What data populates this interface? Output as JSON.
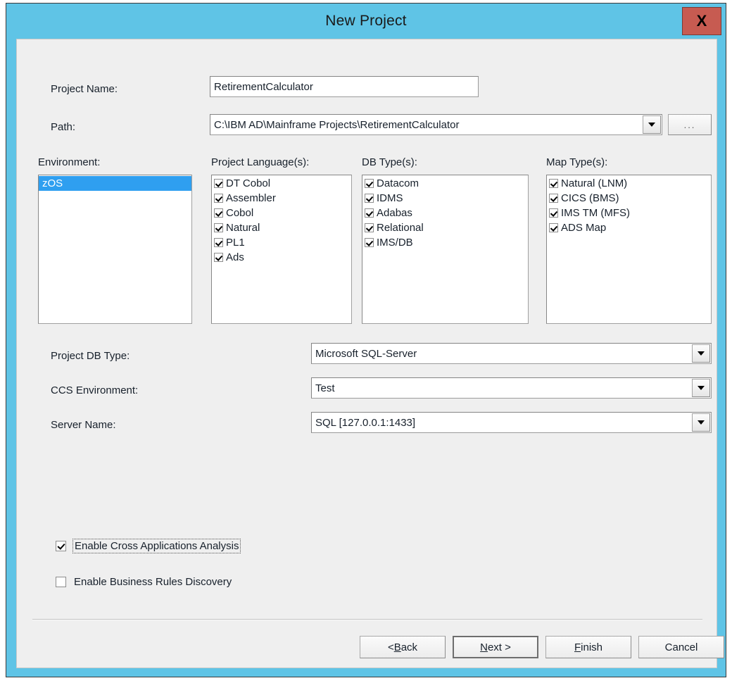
{
  "window": {
    "title": "New Project",
    "close_label": "X",
    "frame_color": "#5fc4e6",
    "close_color": "#c75b51"
  },
  "form": {
    "project_name": {
      "label": "Project Name:",
      "value": "RetirementCalculator"
    },
    "path": {
      "label": "Path:",
      "value": "C:\\IBM AD\\Mainframe Projects\\RetirementCalculator",
      "browse_label": "..."
    },
    "project_db_type": {
      "label": "Project DB Type:",
      "value": "Microsoft SQL-Server"
    },
    "ccs_environment": {
      "label": "CCS Environment:",
      "value": "Test"
    },
    "server_name": {
      "label": "Server Name:",
      "value": "SQL [127.0.0.1:1433]"
    }
  },
  "environment": {
    "label": "Environment:",
    "items": [
      {
        "label": "zOS",
        "selected": true
      }
    ],
    "selection_color": "#2f9ff0"
  },
  "project_languages": {
    "label": "Project Language(s):",
    "items": [
      {
        "label": "DT Cobol",
        "checked": true
      },
      {
        "label": "Assembler",
        "checked": true
      },
      {
        "label": "Cobol",
        "checked": true
      },
      {
        "label": "Natural",
        "checked": true
      },
      {
        "label": "PL1",
        "checked": true
      },
      {
        "label": "Ads",
        "checked": true
      }
    ]
  },
  "db_types": {
    "label": "DB Type(s):",
    "items": [
      {
        "label": "Datacom",
        "checked": true
      },
      {
        "label": "IDMS",
        "checked": true
      },
      {
        "label": "Adabas",
        "checked": true
      },
      {
        "label": "Relational",
        "checked": true
      },
      {
        "label": "IMS/DB",
        "checked": true
      }
    ]
  },
  "map_types": {
    "label": "Map Type(s):",
    "items": [
      {
        "label": "Natural (LNM)",
        "checked": true
      },
      {
        "label": "CICS (BMS)",
        "checked": true
      },
      {
        "label": "IMS TM (MFS)",
        "checked": true
      },
      {
        "label": "ADS Map",
        "checked": true
      }
    ]
  },
  "options": [
    {
      "label": "Enable Cross Applications Analysis",
      "checked": true,
      "focused": true
    },
    {
      "label": "Enable Business Rules Discovery",
      "checked": false,
      "focused": false
    }
  ],
  "buttons": {
    "back": {
      "pre": "< ",
      "accel": "B",
      "post": "ack"
    },
    "next": {
      "pre": "",
      "accel": "N",
      "post": "ext >"
    },
    "finish": {
      "pre": "",
      "accel": "F",
      "post": "inish"
    },
    "cancel": {
      "pre": "",
      "accel": "",
      "post": "Cancel"
    }
  }
}
